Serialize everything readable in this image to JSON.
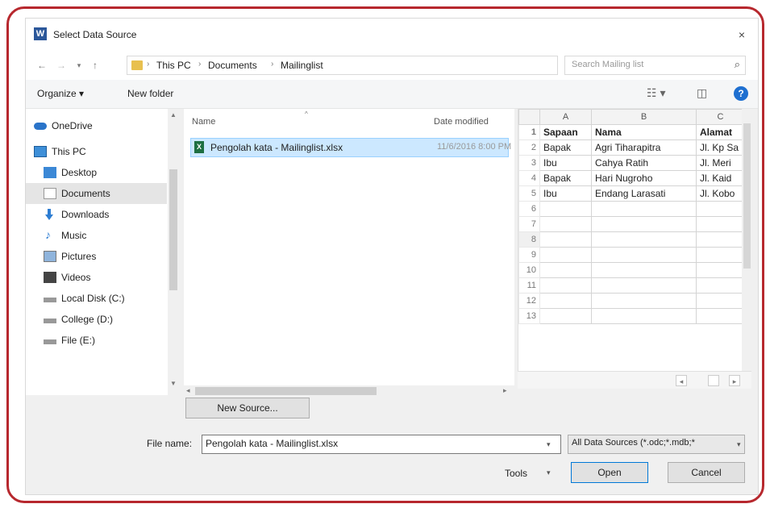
{
  "dialog": {
    "title": "Select Data Source",
    "close_glyph": "×"
  },
  "address": {
    "back_glyph": "←",
    "forward_glyph": "→",
    "recent_glyph": "▾",
    "up_glyph": "↑",
    "breadcrumbs": [
      "This PC",
      "Documents",
      "Mailinglist"
    ],
    "separator": "›",
    "dropdown_glyph": "⌄",
    "refresh_glyph": "↻",
    "search_placeholder": "Search Mailing list",
    "search_glyph": "⌕"
  },
  "toolbar": {
    "organize": "Organize ▾",
    "new_folder": "New folder",
    "view_glyph": "☷ ▾",
    "pane_glyph": "◫",
    "help_glyph": "?"
  },
  "nav": {
    "items": [
      {
        "label": "OneDrive",
        "icon": "cloud-icon"
      },
      {
        "label": "This PC",
        "icon": "computer-icon"
      },
      {
        "label": "Desktop",
        "icon": "desktop-icon"
      },
      {
        "label": "Documents",
        "icon": "documents-icon"
      },
      {
        "label": "Downloads",
        "icon": "download-icon"
      },
      {
        "label": "Music",
        "icon": "music-icon"
      },
      {
        "label": "Pictures",
        "icon": "pictures-icon"
      },
      {
        "label": "Videos",
        "icon": "videos-icon"
      },
      {
        "label": "Local Disk (C:)",
        "icon": "drive-icon"
      },
      {
        "label": "College (D:)",
        "icon": "drive-icon"
      },
      {
        "label": "File (E:)",
        "icon": "drive-icon"
      }
    ],
    "selected": "Documents"
  },
  "files": {
    "col_name": "Name",
    "col_date": "Date modified",
    "rows": [
      {
        "name": "Pengolah kata - Mailinglist.xlsx",
        "date": "11/6/2016 8:00 PM"
      }
    ]
  },
  "preview": {
    "columns": [
      "A",
      "B",
      "C"
    ],
    "rows": [
      [
        "Sapaan",
        "Nama",
        "Alamat"
      ],
      [
        "Bapak",
        "Agri Tiharapitra",
        "Jl. Kp Sa"
      ],
      [
        "Ibu",
        "Cahya Ratih",
        "Jl. Meri"
      ],
      [
        "Bapak",
        "Hari Nugroho",
        "Jl. Kaid"
      ],
      [
        "Ibu",
        "Endang Larasati",
        "Jl. Kobo"
      ],
      [
        "",
        "",
        ""
      ],
      [
        "",
        "",
        ""
      ],
      [
        "",
        "",
        ""
      ],
      [
        "",
        "",
        ""
      ],
      [
        "",
        "",
        ""
      ],
      [
        "",
        "",
        ""
      ],
      [
        "",
        "",
        ""
      ],
      [
        "",
        "",
        ""
      ]
    ],
    "row_numbers": [
      "1",
      "2",
      "3",
      "4",
      "5",
      "6",
      "7",
      "8",
      "9",
      "10",
      "11",
      "12",
      "13"
    ]
  },
  "bottom": {
    "new_source": "New Source...",
    "file_name_label": "File name:",
    "file_name_value": "Pengolah kata - Mailinglist.xlsx",
    "file_type": "All Data Sources (*.odc;*.mdb;*",
    "tools": "Tools",
    "open": "Open",
    "cancel": "Cancel"
  }
}
